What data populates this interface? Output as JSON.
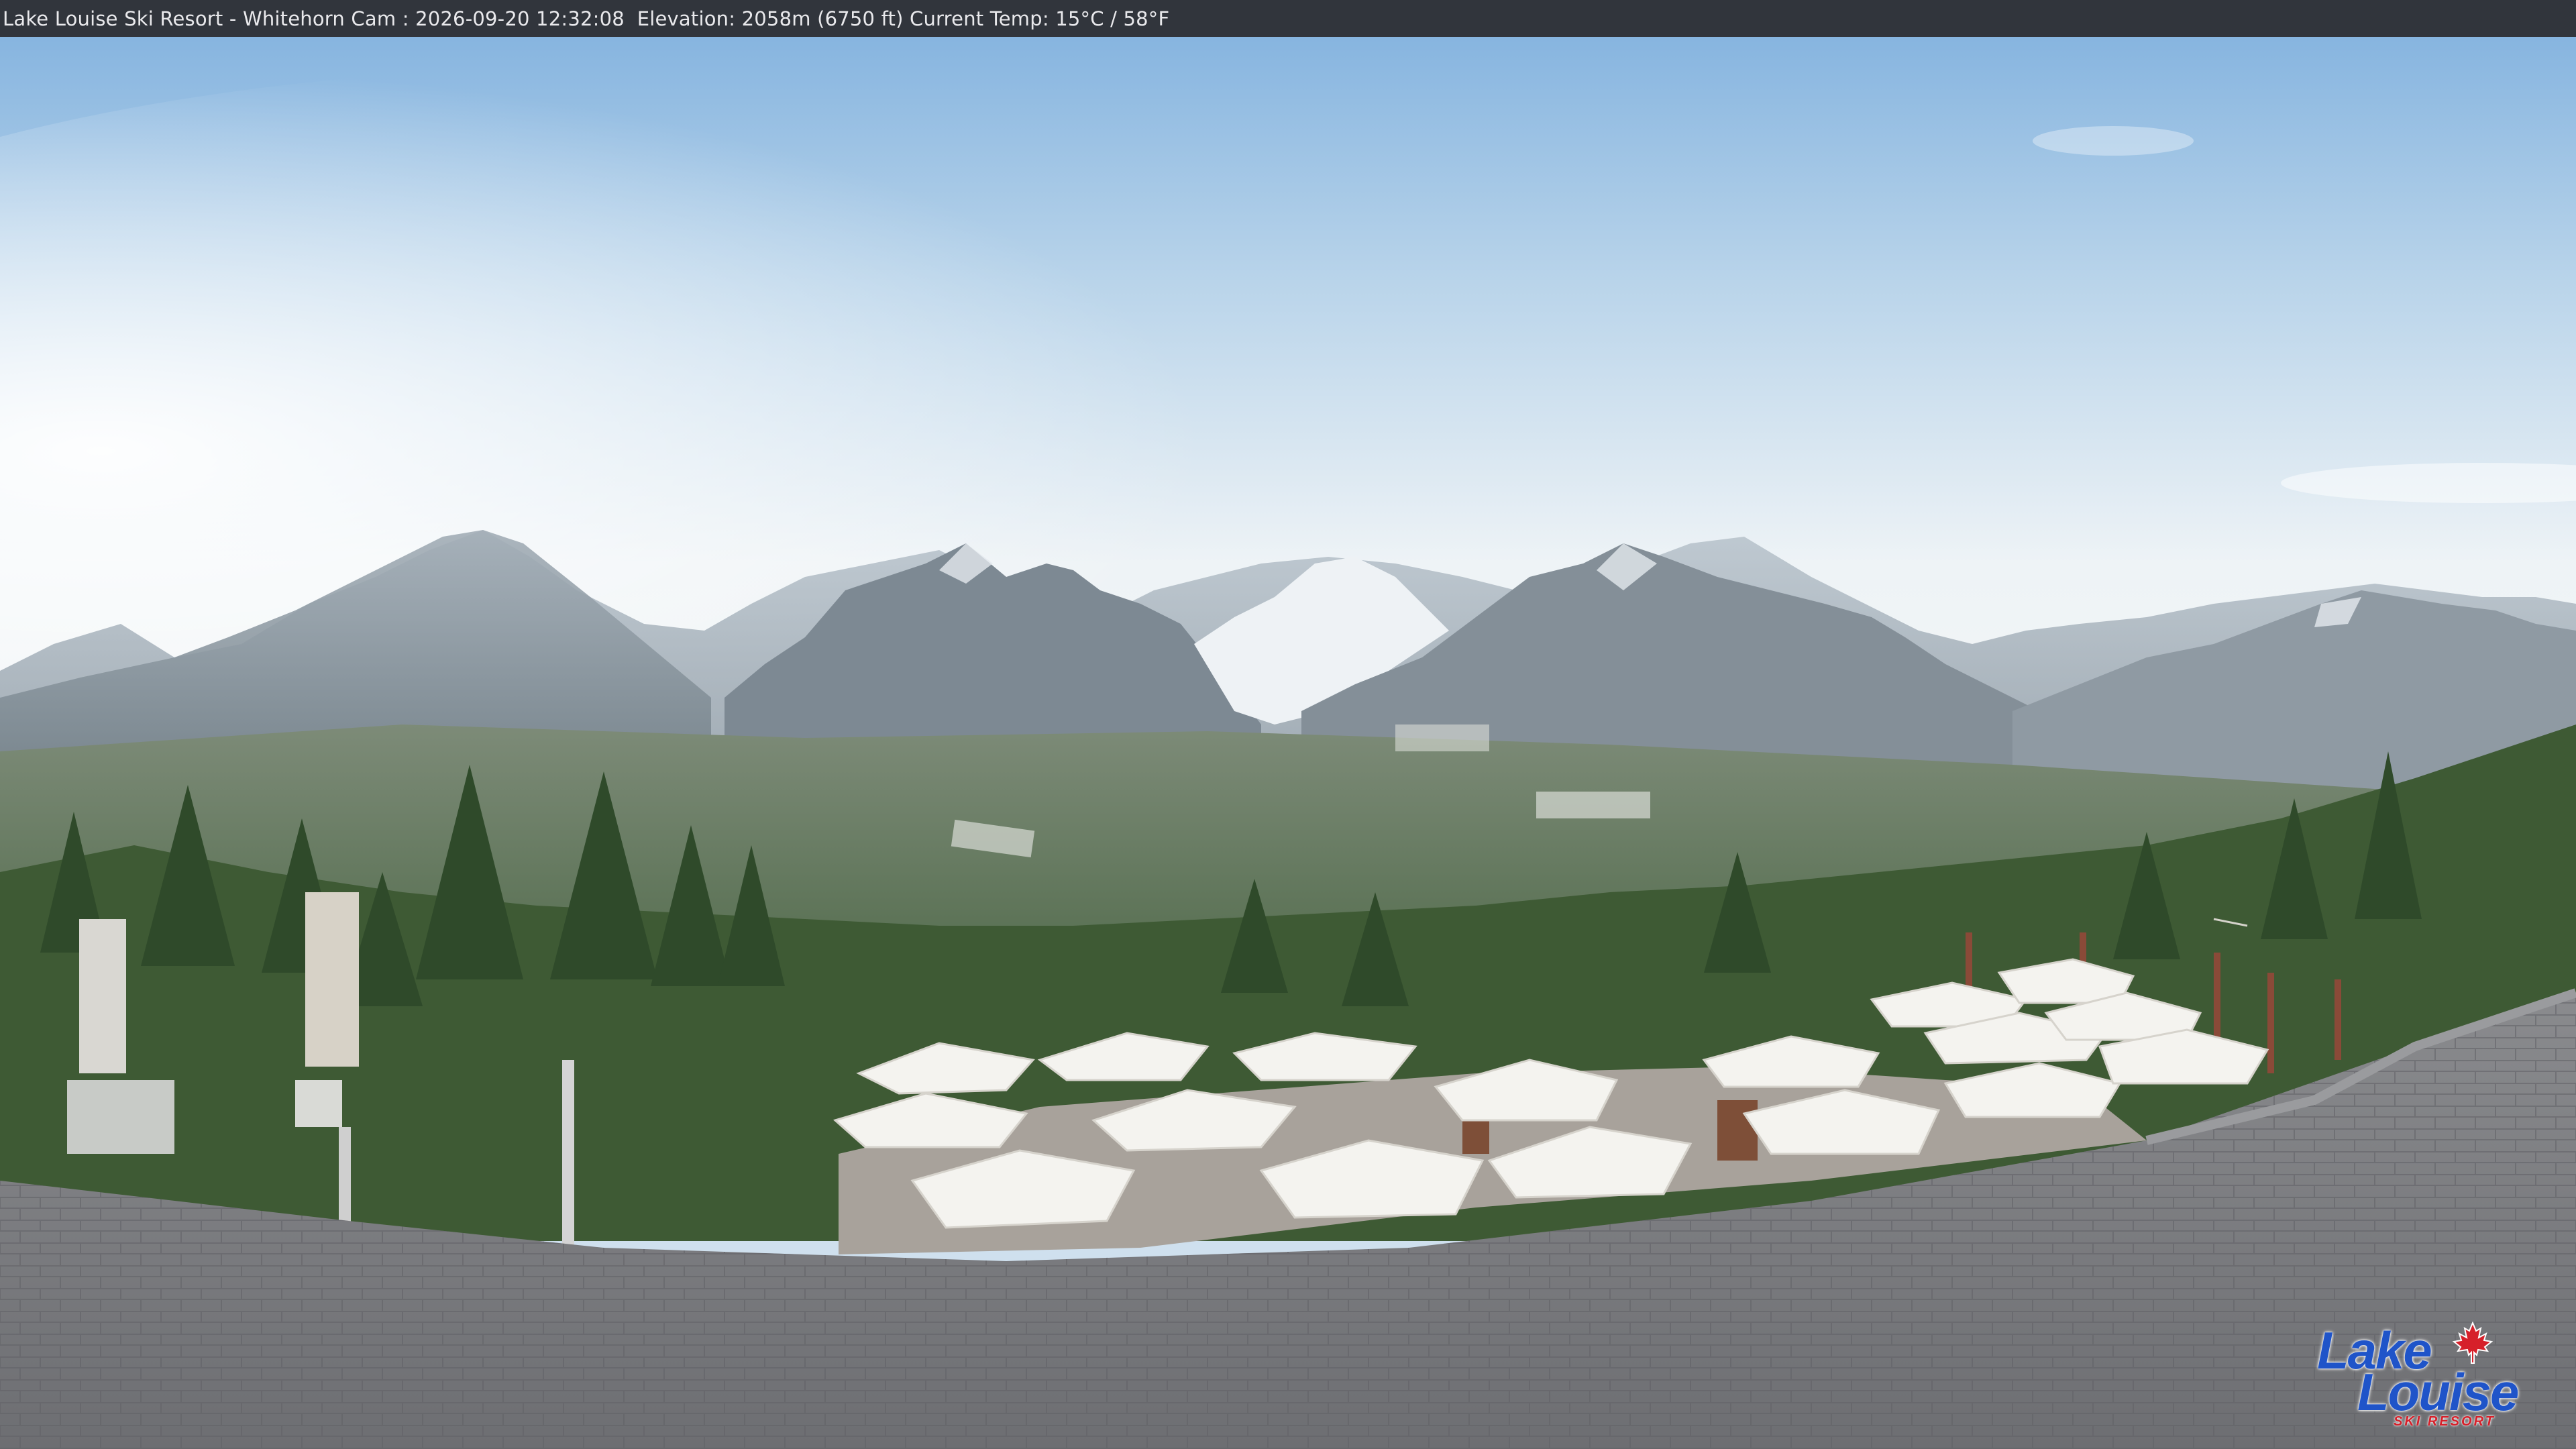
{
  "overlay": {
    "caption": "Lake Louise Ski Resort - Whitehorn Cam : 2026-09-20 12:32:08  Elevation: 2058m (6750 ft) Current Temp: 15°C / 58°F"
  },
  "logo": {
    "line1": "Lake",
    "line2": "Louise",
    "tagline": "SKI RESORT",
    "icon": "maple-leaf-icon"
  },
  "colors": {
    "sky_top": "#8db8e0",
    "sky_haze": "#f2f6f8",
    "mountain": "#7f8a94",
    "snow": "#e6ebef",
    "forest": "#3f5a34",
    "roof": "#7c7d80",
    "umbrella": "#f4f3ef",
    "logo_blue": "#1f54c9",
    "logo_red": "#d6202a"
  }
}
